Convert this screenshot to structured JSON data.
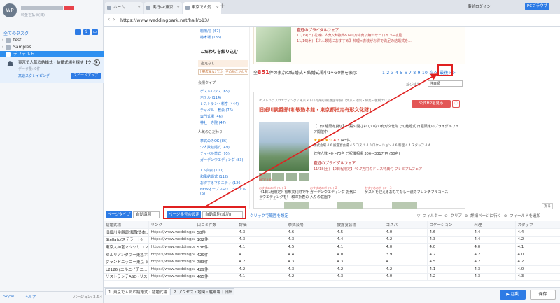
{
  "sidebar": {
    "brand": "WP",
    "user_sub": "料金を払う(日)",
    "task_title": "全てのタスク",
    "tree": [
      "test",
      "Samples",
      "デフォルト"
    ],
    "task_name": "東京で人気の結婚式・結婚式場を探す【ウ...",
    "task_status": "データ量: 0件",
    "cloud_label": "高速スクレイピング",
    "speed_btn": "スピードアップ",
    "skype": "Skype",
    "help": "ヘルプ",
    "version": "バージョン: 3.6.4"
  },
  "browser": {
    "tabs": [
      "ホーム",
      "実行中:東京",
      "東京で人気..."
    ],
    "login": "事前ログイン",
    "pc": "PCブラウザ",
    "url": "https://www.weddingpark.net/hall/p13/"
  },
  "web": {
    "filter_top": [
      "駒場/喜 (67)",
      "椿木場 (136)"
    ],
    "filter_head": "こだわりを絞り込む",
    "not_set": "指定なし",
    "chip1": "上野広尾など(1)",
    "chip2": "その他こだわり",
    "venue_type_head": "会場タイプ",
    "venue_types": [
      "ゲストハウス (65)",
      "ホテル (114)",
      "レストラン・料亭 (444)",
      "チャペル・教会 (76)",
      "専門式場 (46)",
      "神社・寺院 (47)"
    ],
    "pref_head": "人気のこだわり",
    "prefs": [
      "挙式のみOK (86)",
      "少人数結婚式 (49)",
      "チャペル挙式 (95)",
      "ガーデンウエディング (83)",
      "1.5次会 (100)",
      "和風結婚式 (112)",
      "お得するマタニティ (126)",
      "NEWオープン&リニューアル (6)"
    ],
    "results_pre": "全",
    "results_count": "851",
    "results_post": "件の東京の結婚式・結婚式場中1〜30件を表示",
    "pager": "1 2 3 4 5 6 7 8 9 10",
    "next": "次へ",
    "next_tail": "最後>>",
    "sort_label": "並び替え",
    "sort_value": "注目順",
    "fair_title": "直近のブライダルフェア",
    "fair_lines": [
      {
        "date": "11/19(日)",
        "text": "花嫁に人気5大特典&140万特典 / 無料サーロイン&オ見..."
      },
      {
        "date": "11/16(木)",
        "text": "【少人数婚におすすめ】料理×衣装がお得で満足の結婚式を..."
      }
    ],
    "card_tags": "ゲストハウスウエディング / 東京メトロ有楽町線(護国寺駅)（文京・池袋・練馬・板橋エリア）",
    "card_name": "旧細川侯爵邸(和敬塾本館・東京都指定有形文化財)",
    "official": "公式HPを見る",
    "heart": "♡",
    "card_desc": "【1日1組限定貸切】一般公開されていない有形文化財での結婚式 日程限定のブライダルフェア開催中",
    "rating_stars": "★★★★☆",
    "rating_value": "4.3",
    "rating_count": "(45件)",
    "scores": "挙式会場 4.6  披露宴会場 4.5  コスパ 4.0  ロケーション 4.6  料理 4.4  スタッフ 4.4",
    "guests": "収容人数 40〜70名   ご祝儀相場 306〜331万円 (60名)",
    "fair2_title": "直近のブライダルフェア",
    "fair2_date": "11/18(土)",
    "fair2_text": "【2日程限定】40.7万円のドレス特典付 プレミアムフェア",
    "pickup": "PICK UP",
    "picks": [
      {
        "label": "おすすめのポイント1",
        "text": "《1日1組限定》有形文化財で叶うウエディングを！ 和洋折衷の造りが特徴のモダンデザインな邸宅"
      },
      {
        "label": "おすすめのポイント2",
        "text": "ガーデンウエディング お気に入りの庭園で"
      },
      {
        "label": "おすすめのポイント3",
        "text": "ゲストを迎えるおもてなし一流のフレンチフルコース"
      }
    ]
  },
  "panel": {
    "page_type_label": "ページタイプ",
    "page_type_value": "自動識別",
    "pn_label": "ページ番号の設定",
    "pn_value": "自動識別(成功)",
    "click_set": "クリックで範囲を設定",
    "tools": "▽ フィルター  ⊖ クリア  ⊕ 詳細ページに行く  ⊕ フィールドを追加",
    "fold": "折る",
    "headers": [
      "結婚式場",
      "リンク",
      "口コミ件数",
      "評価",
      "挙式会場",
      "披露宴会場",
      "コスパ",
      "ロケーション",
      "料理",
      "スタッフ"
    ],
    "rows": [
      [
        "旧細川侯爵邸(和敬塾本...",
        "https://www.weddingpar...",
        "58件",
        "4.3",
        "4.6",
        "4.5",
        "4.0",
        "4.6",
        "4.4",
        "4.4"
      ],
      [
        "Stellato(ステラート)",
        "https://www.weddingpar...",
        "102件",
        "4.3",
        "4.3",
        "4.4",
        "4.2",
        "4.3",
        "4.4",
        "4.2"
      ],
      [
        "東京大神宮マツヤサロン",
        "https://www.weddingpar...",
        "538件",
        "4.1",
        "4.5",
        "4.1",
        "4.0",
        "4.0",
        "4.0",
        "4.1"
      ],
      [
        "セルリアンタワー東急ホ...",
        "https://www.weddingpar...",
        "429件",
        "4.1",
        "4.4",
        "4.0",
        "3.9",
        "4.2",
        "4.2",
        "4.0"
      ],
      [
        "グランドニッコー東京 台...",
        "https://www.weddingpar...",
        "783件",
        "4.2",
        "4.3",
        "4.3",
        "4.1",
        "4.5",
        "4.2",
        "4.2"
      ],
      [
        "L2126 (エルニイチニ...",
        "https://www.weddingpar...",
        "429件",
        "4.2",
        "4.3",
        "4.2",
        "4.2",
        "4.1",
        "4.3",
        "4.0"
      ],
      [
        "リストランテASO (リス...",
        "https://www.weddingpar...",
        "465件",
        "4.1",
        "4.2",
        "4.3",
        "4.0",
        "4.2",
        "4.3",
        "4.3"
      ]
    ],
    "bottom_tabs": [
      "1. 東京で人気の結婚式・結婚式場...",
      "2. アクセス・地図・駐車場｜旧細..."
    ],
    "run": "▶ 起動",
    "save": "保存"
  },
  "colors": {
    "accent": "#2d7be5",
    "highlight": "#e02020",
    "brand_red": "#d84c3b"
  }
}
